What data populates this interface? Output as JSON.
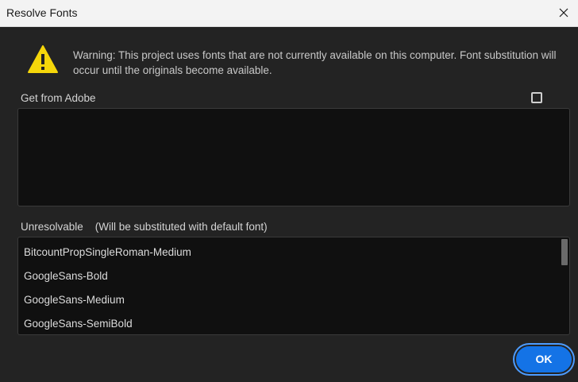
{
  "window": {
    "title": "Resolve Fonts",
    "close_icon": "close-icon"
  },
  "warning": {
    "icon": "warning-triangle-icon",
    "text": "Warning: This project uses fonts that are not currently available on this computer. Font substitution will occur until the originals become available.",
    "icon_color": "#f5d60a"
  },
  "adobe_section": {
    "label": "Get from Adobe",
    "checkbox_checked": false,
    "items": []
  },
  "unresolvable_section": {
    "label": "Unresolvable    (Will be substituted with default font)",
    "items": [
      "BitcountPropSingleRoman-Medium",
      "GoogleSans-Bold",
      "GoogleSans-Medium",
      "GoogleSans-SemiBold"
    ]
  },
  "buttons": {
    "ok_label": "OK"
  },
  "colors": {
    "accent": "#1473e6",
    "background": "#232323",
    "list_background": "#101010"
  }
}
